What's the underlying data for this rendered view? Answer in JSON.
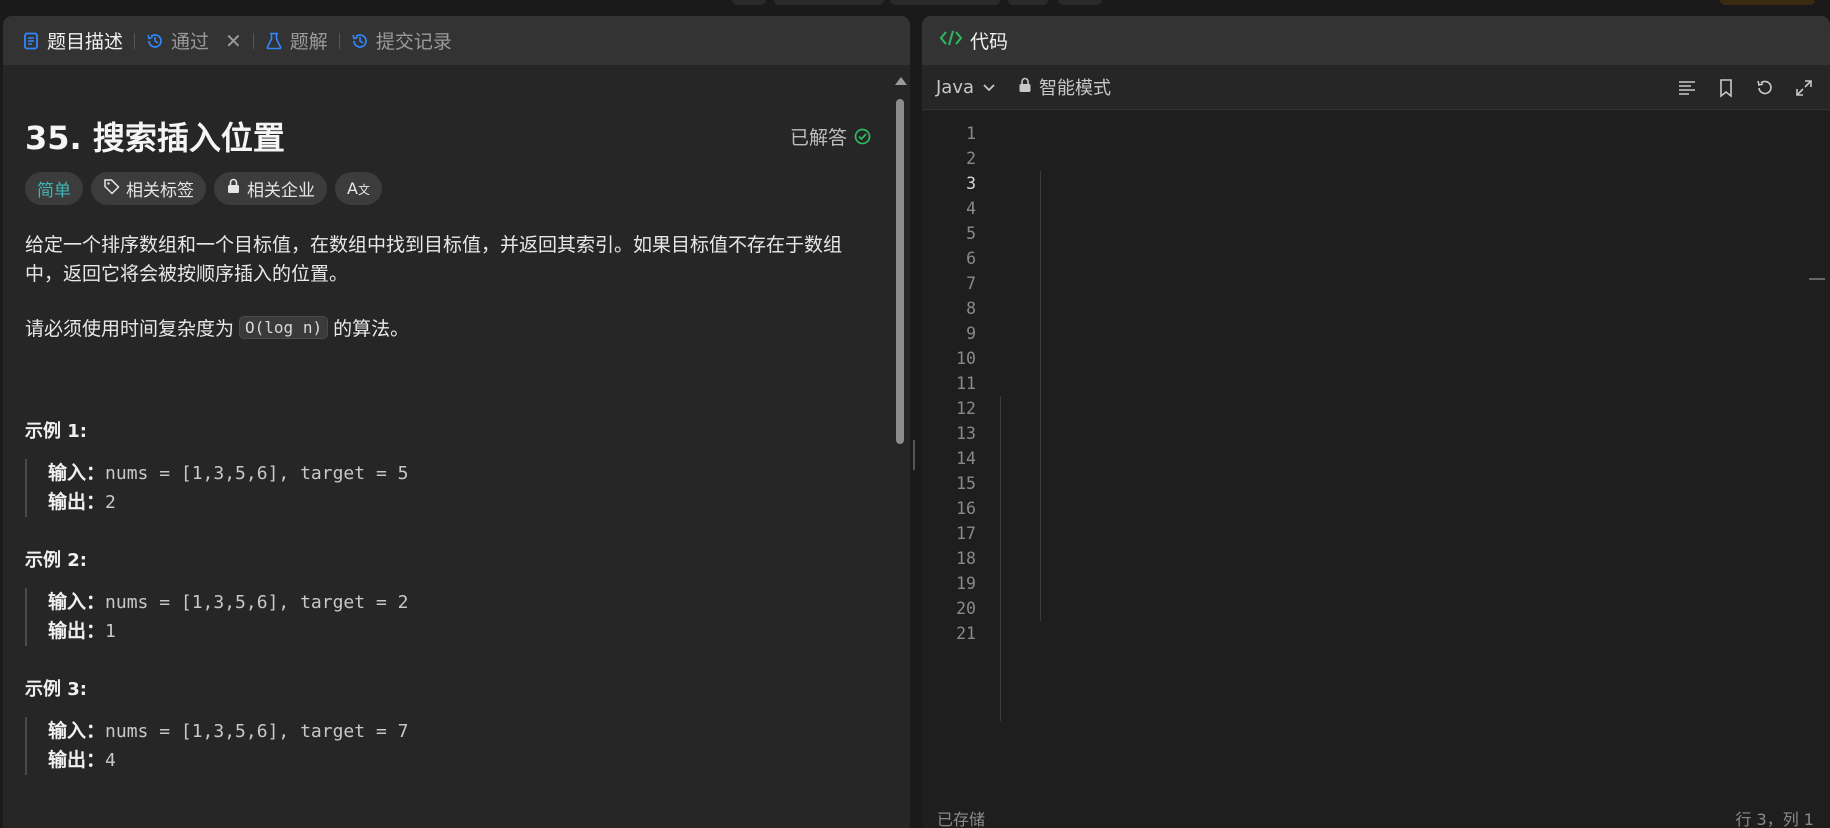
{
  "left_tabs": {
    "description": "题目描述",
    "accepted": "通过",
    "solutions": "题解",
    "submissions": "提交记录"
  },
  "problem": {
    "title": "35. 搜索插入位置",
    "status": "已解答",
    "difficulty": "简单",
    "tags_btn": "相关标签",
    "companies_btn": "相关企业",
    "translate_btn": "A文",
    "description": "给定一个排序数组和一个目标值，在数组中找到目标值，并返回其索引。如果目标值不存在于数组中，返回它将会被按顺序插入的位置。",
    "requirement_pre": "请必须使用时间复杂度为",
    "requirement_code": "O(log n)",
    "requirement_post": "的算法。",
    "examples": [
      {
        "title": "示例 1:",
        "input_label": "输入：",
        "input": "nums = [1,3,5,6], target = 5",
        "output_label": "输出：",
        "output": "2"
      },
      {
        "title": "示例 2:",
        "input_label": "输入：",
        "input": "nums = [1,3,5,6], target = 2",
        "output_label": "输出：",
        "output": "1"
      },
      {
        "title": "示例 3:",
        "input_label": "输入：",
        "input": "nums = [1,3,5,6], target = 7",
        "output_label": "输出：",
        "output": "4"
      }
    ]
  },
  "code_panel": {
    "tab": "代码",
    "language": "Java",
    "mode": "智能模式",
    "status_left": "已存储",
    "status_right": "行 3，列 1",
    "current_line": 3,
    "line_numbers": [
      "1",
      "2",
      "3",
      "4",
      "5",
      "6",
      "7",
      "8",
      "9",
      "10",
      "11",
      "12",
      "13",
      "14",
      "15",
      "16",
      "17",
      "18",
      "19",
      "20",
      "21"
    ]
  },
  "colors": {
    "accent_blue": "#2f88ff",
    "solved_green": "#2cbb5d",
    "easy_teal": "#3fb6b4",
    "code_tab_green": "#2cbb5d"
  }
}
